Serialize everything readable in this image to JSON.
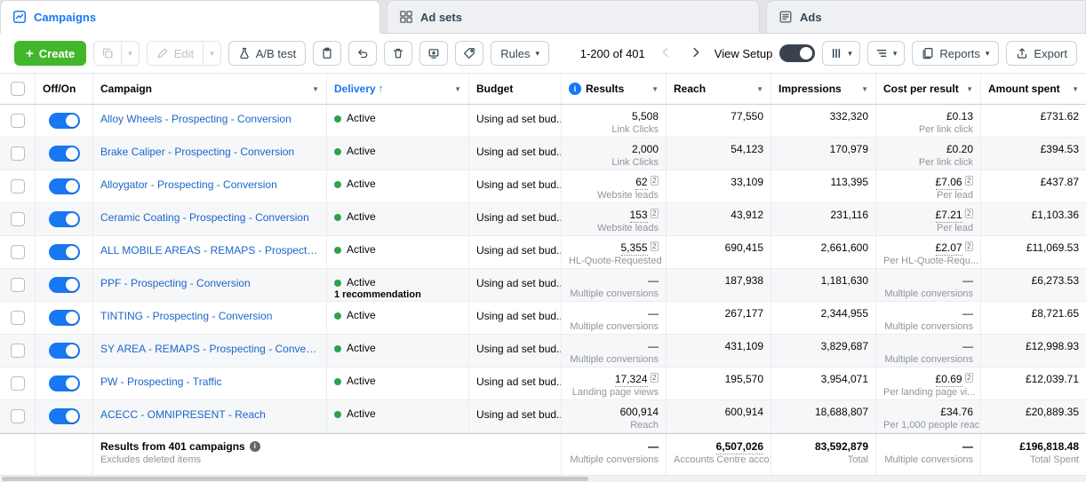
{
  "colors": {
    "accent_green": "#42b72a",
    "accent_blue": "#1877f2",
    "link_blue": "#1b66c9",
    "delivery_green": "#31a24c"
  },
  "tabs": {
    "campaigns": "Campaigns",
    "ad_sets": "Ad sets",
    "ads": "Ads"
  },
  "toolbar": {
    "create_label": "Create",
    "edit_label": "Edit",
    "ab_test_label": "A/B test",
    "rules_label": "Rules",
    "pagination": "1-200 of 401",
    "view_setup_label": "View Setup",
    "reports_label": "Reports",
    "export_label": "Export"
  },
  "table": {
    "headers": {
      "off_on": "Off/On",
      "campaign": "Campaign",
      "delivery": "Delivery",
      "budget": "Budget",
      "results": "Results",
      "reach": "Reach",
      "impressions": "Impressions",
      "cost_per_result": "Cost per result",
      "amount_spent": "Amount spent"
    },
    "rows": [
      {
        "name": "Alloy Wheels - Prospecting - Conversion",
        "delivery": "Active",
        "delivery_note": "",
        "budget": "Using ad set bud...",
        "results": "5,508",
        "results_sub": "Link Clicks",
        "results_flag": false,
        "reach": "77,550",
        "impressions": "332,320",
        "cpr": "£0.13",
        "cpr_sub": "Per link click",
        "cpr_flag": false,
        "spent": "£731.62",
        "enabled": true
      },
      {
        "name": "Brake Caliper - Prospecting - Conversion",
        "delivery": "Active",
        "delivery_note": "",
        "budget": "Using ad set bud...",
        "results": "2,000",
        "results_sub": "Link Clicks",
        "results_flag": false,
        "reach": "54,123",
        "impressions": "170,979",
        "cpr": "£0.20",
        "cpr_sub": "Per link click",
        "cpr_flag": false,
        "spent": "£394.53",
        "enabled": true
      },
      {
        "name": "Alloygator - Prospecting - Conversion",
        "delivery": "Active",
        "delivery_note": "",
        "budget": "Using ad set bud...",
        "results": "62",
        "results_sub": "Website leads",
        "results_flag": true,
        "reach": "33,109",
        "impressions": "113,395",
        "cpr": "£7.06",
        "cpr_sub": "Per lead",
        "cpr_flag": true,
        "spent": "£437.87",
        "enabled": true
      },
      {
        "name": "Ceramic Coating - Prospecting - Conversion",
        "delivery": "Active",
        "delivery_note": "",
        "budget": "Using ad set bud...",
        "results": "153",
        "results_sub": "Website leads",
        "results_flag": true,
        "reach": "43,912",
        "impressions": "231,116",
        "cpr": "£7.21",
        "cpr_sub": "Per lead",
        "cpr_flag": true,
        "spent": "£1,103.36",
        "enabled": true
      },
      {
        "name": "ALL MOBILE AREAS - REMAPS - Prospecting - ...",
        "delivery": "Active",
        "delivery_note": "",
        "budget": "Using ad set bud...",
        "results": "5,355",
        "results_sub": "HL-Quote-Requested",
        "results_flag": true,
        "reach": "690,415",
        "impressions": "2,661,600",
        "cpr": "£2.07",
        "cpr_sub": "Per HL-Quote-Requ...",
        "cpr_flag": true,
        "spent": "£11,069.53",
        "enabled": true
      },
      {
        "name": "PPF - Prospecting - Conversion",
        "delivery": "Active",
        "delivery_note": "1 recommendation",
        "budget": "Using ad set bud...",
        "results": "—",
        "results_sub": "Multiple conversions",
        "results_flag": false,
        "reach": "187,938",
        "impressions": "1,181,630",
        "cpr": "—",
        "cpr_sub": "Multiple conversions",
        "cpr_flag": false,
        "spent": "£6,273.53",
        "enabled": true
      },
      {
        "name": "TINTING - Prospecting - Conversion",
        "delivery": "Active",
        "delivery_note": "",
        "budget": "Using ad set bud...",
        "results": "—",
        "results_sub": "Multiple conversions",
        "results_flag": false,
        "reach": "267,177",
        "impressions": "2,344,955",
        "cpr": "—",
        "cpr_sub": "Multiple conversions",
        "cpr_flag": false,
        "spent": "£8,721.65",
        "enabled": true
      },
      {
        "name": "SY AREA - REMAPS - Prospecting - Conversion",
        "delivery": "Active",
        "delivery_note": "",
        "budget": "Using ad set bud...",
        "results": "—",
        "results_sub": "Multiple conversions",
        "results_flag": false,
        "reach": "431,109",
        "impressions": "3,829,687",
        "cpr": "—",
        "cpr_sub": "Multiple conversions",
        "cpr_flag": false,
        "spent": "£12,998.93",
        "enabled": true
      },
      {
        "name": "PW - Prospecting - Traffic",
        "delivery": "Active",
        "delivery_note": "",
        "budget": "Using ad set bud...",
        "results": "17,324",
        "results_sub": "Landing page views",
        "results_flag": true,
        "reach": "195,570",
        "impressions": "3,954,071",
        "cpr": "£0.69",
        "cpr_sub": "Per landing page vi...",
        "cpr_flag": true,
        "spent": "£12,039.71",
        "enabled": true
      },
      {
        "name": "ACECC - OMNIPRESENT - Reach",
        "delivery": "Active",
        "delivery_note": "",
        "budget": "Using ad set bud...",
        "results": "600,914",
        "results_sub": "Reach",
        "results_flag": false,
        "reach": "600,914",
        "impressions": "18,688,807",
        "cpr": "£34.76",
        "cpr_sub": "Per 1,000 people reac...",
        "cpr_flag": false,
        "spent": "£20,889.35",
        "enabled": true
      }
    ],
    "footer": {
      "title": "Results from 401 campaigns",
      "subtitle": "Excludes deleted items",
      "results": "—",
      "results_sub": "Multiple conversions",
      "reach": "6,507,026",
      "reach_sub": "Accounts Centre acco...",
      "impressions": "83,592,879",
      "impressions_sub": "Total",
      "cpr": "—",
      "cpr_sub": "Multiple conversions",
      "spent": "£196,818.48",
      "spent_sub": "Total Spent"
    }
  }
}
